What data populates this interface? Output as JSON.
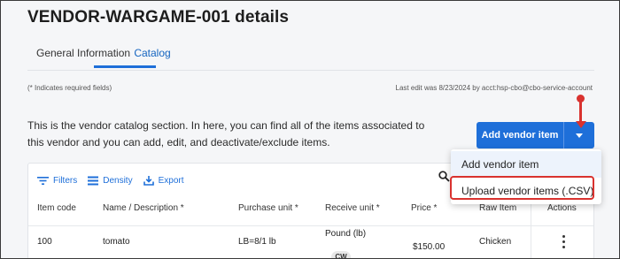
{
  "page": {
    "title": "VENDOR-WARGAME-001 details",
    "required_note": "(* Indicates required fields)",
    "last_edit": "Last edit was 8/23/2024 by acct:hsp-cbo@cbo-service-account"
  },
  "tabs": [
    {
      "label": "General Information",
      "active": false
    },
    {
      "label": "Catalog",
      "active": true
    }
  ],
  "catalog": {
    "intro": "This is the vendor catalog section. In here, you can find all of the items associated to this vendor and you can add, edit, and deactivate/exclude items.",
    "add_button": "Add vendor item",
    "dropdown_menu": [
      "Add vendor item",
      "Upload vendor items (.CSV)"
    ]
  },
  "toolbar": {
    "filters": "Filters",
    "density": "Density",
    "export": "Export"
  },
  "table": {
    "columns": [
      "Item code",
      "Name / Description *",
      "Purchase unit *",
      "Receive unit *",
      "Price *",
      "Raw Item",
      "Actions"
    ],
    "rows": [
      {
        "item_code": "100",
        "name": "tomato",
        "purchase_unit": "LB=8/1 lb",
        "receive_unit": "Pound (lb)",
        "receive_badge": "CW",
        "price": "$150.00",
        "raw_item": "Chicken"
      }
    ]
  },
  "colors": {
    "accent": "#1e6fd9",
    "annotation": "#d9322f"
  },
  "icons": [
    "filter-icon",
    "density-icon",
    "export-icon",
    "search-icon",
    "chevron-down-icon",
    "more-vert-icon"
  ]
}
